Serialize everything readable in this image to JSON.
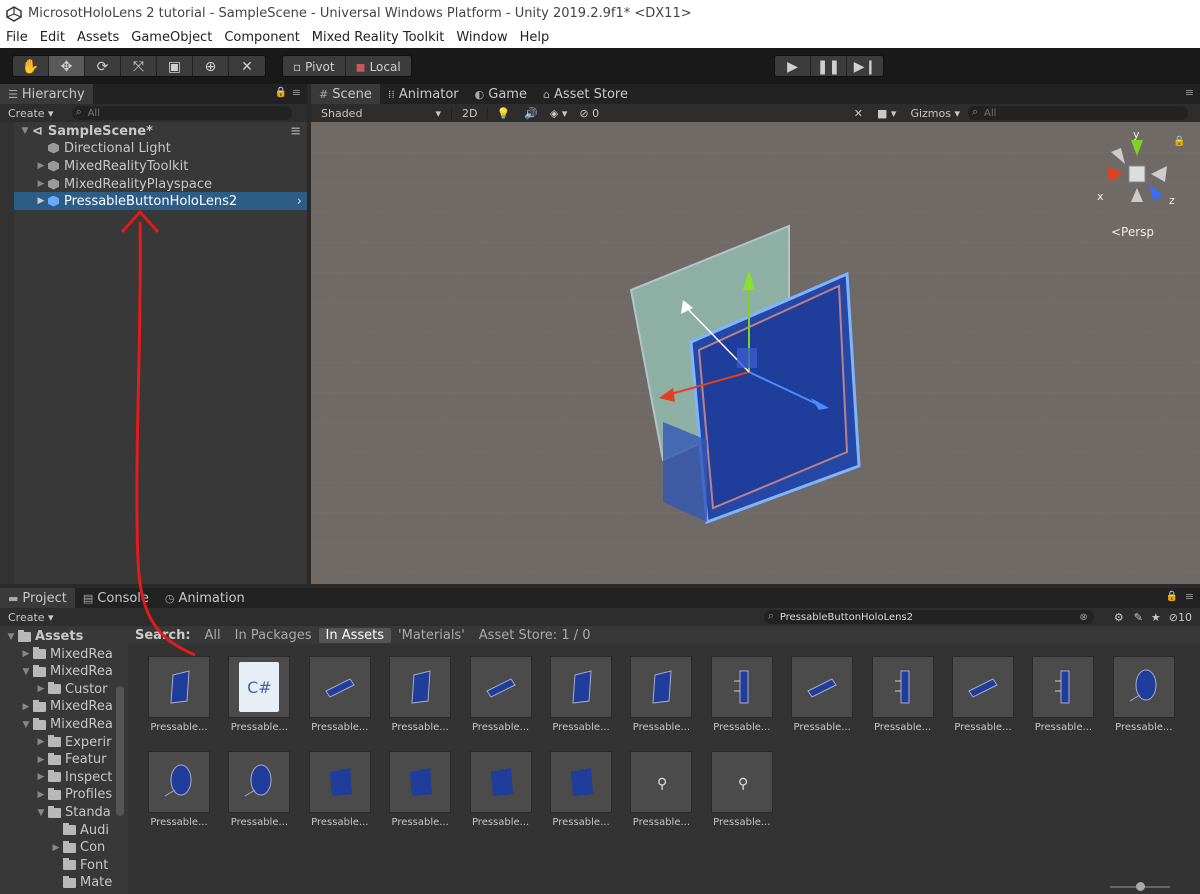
{
  "window": {
    "title": "MicrosotHoloLens 2 tutorial - SampleScene - Universal Windows Platform - Unity 2019.2.9f1* <DX11>"
  },
  "menu": [
    "File",
    "Edit",
    "Assets",
    "GameObject",
    "Component",
    "Mixed Reality Toolkit",
    "Window",
    "Help"
  ],
  "toolbar": {
    "tools": [
      "hand-icon",
      "move-icon",
      "rotate-icon",
      "scale-icon",
      "rect-icon",
      "transform-icon",
      "custom-tool-icon"
    ],
    "pivot": "Pivot",
    "local": "Local",
    "play": [
      "play-icon",
      "pause-icon",
      "step-icon"
    ]
  },
  "hierarchy": {
    "tab": "Hierarchy",
    "create": "Create",
    "search_placeholder": "All",
    "scene": "SampleScene*",
    "items": [
      "Directional Light",
      "MixedRealityToolkit",
      "MixedRealityPlayspace",
      "PressableButtonHoloLens2"
    ]
  },
  "scene_view": {
    "tabs": [
      "Scene",
      "Animator",
      "Game",
      "Asset Store"
    ],
    "shading": "Shaded",
    "mode_2d": "2D",
    "gizmo_count": "0",
    "gizmos": "Gizmos",
    "search_placeholder": "All",
    "axes": {
      "x": "x",
      "y": "y",
      "z": "z"
    },
    "persp": "<Persp"
  },
  "project": {
    "tabs": [
      "Project",
      "Console",
      "Animation"
    ],
    "create": "Create",
    "search_query": "PressableButtonHoloLens2",
    "hidden_count": "10",
    "search_label": "Search:",
    "filters": [
      "All",
      "In Packages",
      "In Assets",
      "'Materials'",
      "Asset Store: 1 / 0"
    ],
    "tree": [
      {
        "name": "Assets",
        "depth": 0
      },
      {
        "name": "MixedRea",
        "depth": 1
      },
      {
        "name": "MixedRea",
        "depth": 1
      },
      {
        "name": "Custor",
        "depth": 2
      },
      {
        "name": "MixedRea",
        "depth": 1
      },
      {
        "name": "MixedRea",
        "depth": 1
      },
      {
        "name": "Experir",
        "depth": 2
      },
      {
        "name": "Featur",
        "depth": 2
      },
      {
        "name": "Inspect",
        "depth": 2
      },
      {
        "name": "Profiles",
        "depth": 2
      },
      {
        "name": "Standa",
        "depth": 2
      },
      {
        "name": "Audi",
        "depth": 3
      },
      {
        "name": "Con",
        "depth": 3
      },
      {
        "name": "Font",
        "depth": 3
      },
      {
        "name": "Mate",
        "depth": 3
      }
    ],
    "asset_label": "Pressable...",
    "asset_count": 21
  }
}
